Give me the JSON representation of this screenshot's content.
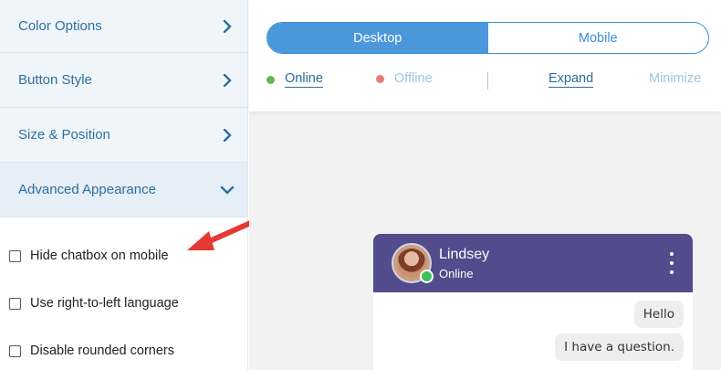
{
  "sidebar": {
    "sections": [
      {
        "label": "Color Options",
        "state": "collapsed"
      },
      {
        "label": "Button Style",
        "state": "collapsed"
      },
      {
        "label": "Size & Position",
        "state": "collapsed"
      },
      {
        "label": "Advanced Appearance",
        "state": "expanded"
      }
    ],
    "options": [
      {
        "label": "Hide chatbox on mobile",
        "checked": false
      },
      {
        "label": "Use right-to-left language",
        "checked": false
      },
      {
        "label": "Disable rounded corners",
        "checked": false
      }
    ]
  },
  "preview": {
    "tabs": [
      {
        "label": "Desktop",
        "active": true
      },
      {
        "label": "Mobile",
        "active": false
      }
    ],
    "status": {
      "online": "Online",
      "offline": "Offline",
      "expand": "Expand",
      "minimize": "Minimize"
    },
    "colors": {
      "online_dot": "#67b64a",
      "offline_dot": "#ea7b7b",
      "header_bg": "#524b8c",
      "accent": "#4a97db"
    }
  },
  "chat": {
    "agent_name": "Lindsey",
    "agent_status": "Online",
    "messages": [
      "Hello",
      "I have a question."
    ]
  },
  "icons": {
    "section_collapsed": "chevron-right-icon",
    "section_expanded": "chevron-down-icon",
    "menu": "kebab-menu-icon",
    "annotation": "red-arrow-icon"
  }
}
